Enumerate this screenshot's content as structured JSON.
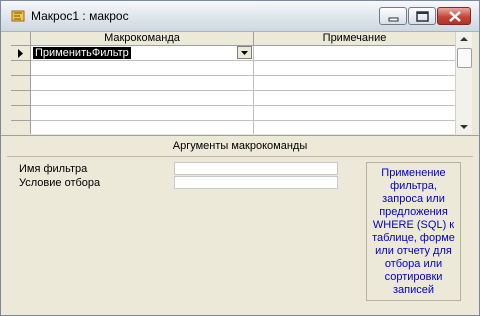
{
  "window": {
    "title": "Макрос1 : макрос",
    "icon": "macro-icon"
  },
  "grid": {
    "columns": [
      "Макрокоманда",
      "Примечание"
    ],
    "rows": [
      {
        "action": "ПрименитьФильтр",
        "note": ""
      },
      {
        "action": "",
        "note": ""
      },
      {
        "action": "",
        "note": ""
      },
      {
        "action": "",
        "note": ""
      },
      {
        "action": "",
        "note": ""
      },
      {
        "action": "",
        "note": ""
      }
    ]
  },
  "arguments": {
    "header": "Аргументы макрокоманды",
    "fields": [
      {
        "label": "Имя фильтра",
        "value": ""
      },
      {
        "label": "Условие отбора",
        "value": ""
      }
    ],
    "help_text": "Применение\nфильтра,\nзапроса или\nпредложения\nWHERE (SQL) к\nтаблице, форме\nили отчету для\nотбора или\nсортировки\nзаписей"
  },
  "colors": {
    "help_text": "#0000cc",
    "selection": "#000000"
  }
}
